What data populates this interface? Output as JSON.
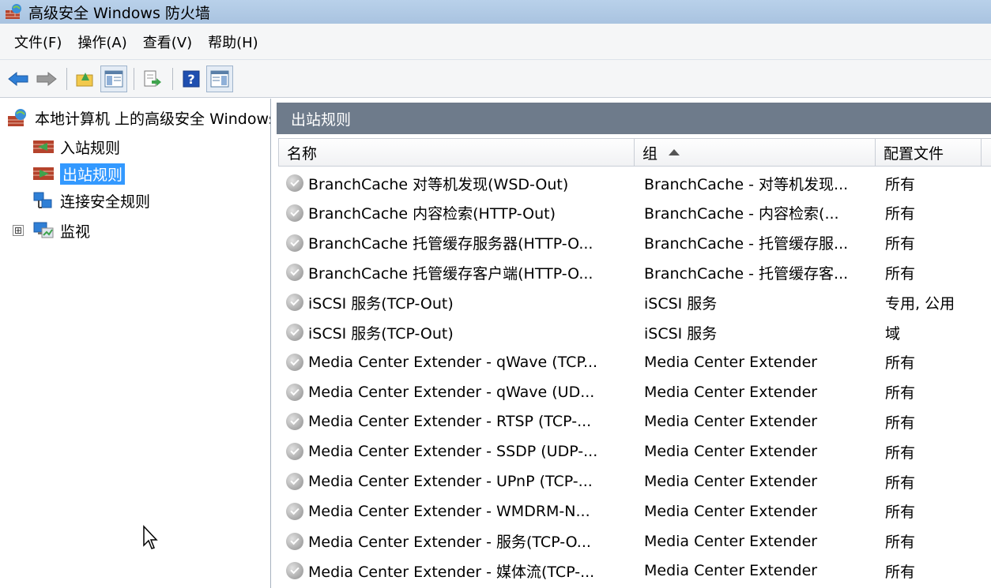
{
  "window": {
    "title": "高级安全 Windows 防火墙"
  },
  "menu": [
    "文件(F)",
    "操作(A)",
    "查看(V)",
    "帮助(H)"
  ],
  "toolbar": {
    "buttons": [
      "back-icon",
      "forward-icon",
      "up-folder-icon",
      "show-hide-console-tree-icon",
      "export-list-icon",
      "help-icon",
      "show-hide-action-pane-icon"
    ]
  },
  "tree": {
    "root": "本地计算机 上的高级安全 Windows 防火墙",
    "items": [
      {
        "label": "入站规则"
      },
      {
        "label": "出站规则",
        "selected": true
      },
      {
        "label": "连接安全规则"
      },
      {
        "label": "监视",
        "expander": "⊞"
      }
    ]
  },
  "pane": {
    "title": "出站规则"
  },
  "columns": [
    "名称",
    "组",
    "配置文件"
  ],
  "rows": [
    {
      "name": "BranchCache 对等机发现(WSD-Out)",
      "group": "BranchCache - 对等机发现...",
      "profile": "所有"
    },
    {
      "name": "BranchCache 内容检索(HTTP-Out)",
      "group": "BranchCache - 内容检索(...",
      "profile": "所有"
    },
    {
      "name": "BranchCache 托管缓存服务器(HTTP-O...",
      "group": "BranchCache - 托管缓存服...",
      "profile": "所有"
    },
    {
      "name": "BranchCache 托管缓存客户端(HTTP-O...",
      "group": "BranchCache - 托管缓存客...",
      "profile": "所有"
    },
    {
      "name": "iSCSI 服务(TCP-Out)",
      "group": "iSCSI 服务",
      "profile": "专用, 公用"
    },
    {
      "name": "iSCSI 服务(TCP-Out)",
      "group": "iSCSI 服务",
      "profile": "域"
    },
    {
      "name": "Media Center Extender - qWave (TCP...",
      "group": "Media Center Extender",
      "profile": "所有"
    },
    {
      "name": "Media Center Extender - qWave (UD...",
      "group": "Media Center Extender",
      "profile": "所有"
    },
    {
      "name": "Media Center Extender - RTSP (TCP-...",
      "group": "Media Center Extender",
      "profile": "所有"
    },
    {
      "name": "Media Center Extender - SSDP (UDP-...",
      "group": "Media Center Extender",
      "profile": "所有"
    },
    {
      "name": "Media Center Extender - UPnP (TCP-...",
      "group": "Media Center Extender",
      "profile": "所有"
    },
    {
      "name": "Media Center Extender - WMDRM-N...",
      "group": "Media Center Extender",
      "profile": "所有"
    },
    {
      "name": "Media Center Extender - 服务(TCP-O...",
      "group": "Media Center Extender",
      "profile": "所有"
    },
    {
      "name": "Media Center Extender - 媒体流(TCP-...",
      "group": "Media Center Extender",
      "profile": "所有"
    }
  ]
}
